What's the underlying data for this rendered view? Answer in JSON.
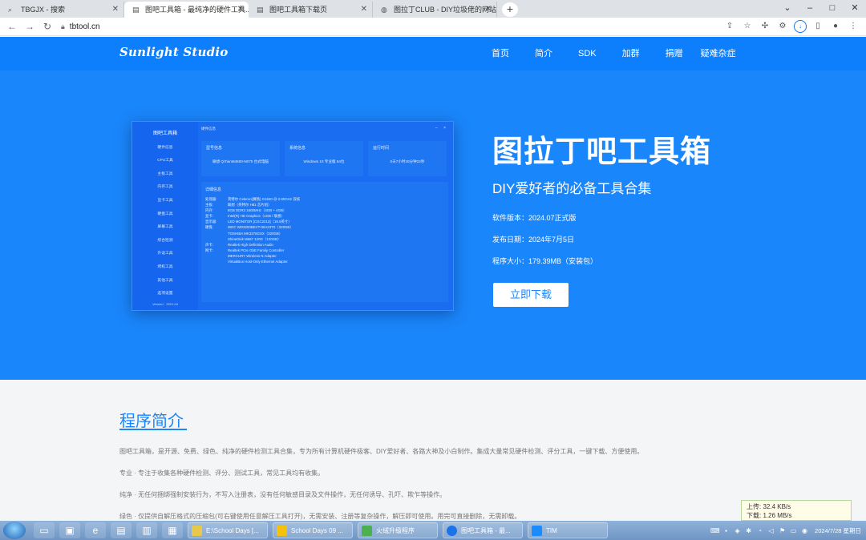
{
  "browser": {
    "tabs": [
      {
        "title": "TBGJX - 搜索",
        "icon": "search-icon",
        "active": false
      },
      {
        "title": "图吧工具箱 - 最纯净的硬件工具...",
        "icon": "page-icon",
        "active": true
      },
      {
        "title": "图吧工具箱下载页",
        "icon": "page-icon",
        "active": false
      },
      {
        "title": "图拉丁CLUB - DIY垃圾佬的网站",
        "icon": "globe-icon",
        "active": false
      }
    ],
    "new_tab": "+",
    "url": "tbtool.cn"
  },
  "site": {
    "logo": "Sunlight Studio",
    "nav": [
      "首页",
      "简介",
      "SDK",
      "加群",
      "捐赠",
      "疑难杂症"
    ]
  },
  "hero": {
    "title": "图拉丁吧工具箱",
    "subtitle": "DIY爱好者的必备工具合集",
    "version": "软件版本：2024.07正式版",
    "release_date": "发布日期：2024年7月5日",
    "size": "程序大小：179.39MB（安装包）",
    "download": "立即下载",
    "app_preview": {
      "sidebar_title": "图吧工具箱",
      "sidebar_items": [
        "硬件信息",
        "CPU工具",
        "主板工具",
        "内存工具",
        "显卡工具",
        "硬盘工具",
        "屏幕工具",
        "综合检测",
        "外设工具",
        "烤机工具",
        "其他工具",
        "选项设置"
      ],
      "version": "Version：2021.04",
      "header": "硬件信息",
      "cards": [
        {
          "title": "型号信息",
          "value": "联想 QiTianM4500-N070 台式电脑"
        },
        {
          "title": "系统信息",
          "value": "Windows 10 专业版 64位"
        },
        {
          "title": "运行时间",
          "value": "0天7小时40分钟22秒"
        }
      ],
      "detail_title": "详细信息",
      "details": [
        {
          "k": "处理器:",
          "v": "英特尔 Celeron(赛扬) G1840 @ 2.80GHz 双核"
        },
        {
          "k": "主板:",
          "v": "联想（英特尔 H81 芯片组）"
        },
        {
          "k": "内存:",
          "v": "8GB DDR3 1600MHz（4GB + 4GB）"
        },
        {
          "k": "显卡:",
          "v": "Intel(R) HD Graphics（1GB / 联想）"
        },
        {
          "k": "显示器:",
          "v": "LED MONITOR [CGC2213]（19.5英寸）"
        },
        {
          "k": "硬盘:",
          "v": "WDC WD3200BEVT-00A23T0（320GB）"
        },
        {
          "k": "",
          "v": "TOSHIBA MK3276GSX（320GB）"
        },
        {
          "k": "",
          "v": "ShineDisk M667 120G（120GB）"
        },
        {
          "k": "声卡:",
          "v": "Realtek High Definition Audio"
        },
        {
          "k": "网卡:",
          "v": "Realtek PCIe GbE Family Controller"
        },
        {
          "k": "",
          "v": "MERCURY Wireless N Adapter"
        },
        {
          "k": "",
          "v": "VirtualBox Host-Only Ethernet Adapter"
        }
      ]
    }
  },
  "intro": {
    "heading": "程序简介",
    "paragraphs": [
      "图吧工具箱，是开源、免费、绿色、纯净的硬件检测工具合集，专为所有计算机硬件极客、DIY爱好者、各路大神及小白制作。集成大量常见硬件检测、评分工具，一键下载、方便使用。",
      "专业 · 专注于收集各种硬件检测、评分、测试工具，常见工具均有收集。",
      "纯净 · 无任何捆绑强制安装行为，不写入注册表，没有任何敏感目录及文件操作，无任何诱导、孔吓、欺乍等操作。",
      "绿色 · 仅提供自解压格式的压缩包(可右键使用任意解压工具打开)，无需安装、注册等复杂操作，解压即可使用。用完可直接删除，无需卸载。"
    ]
  },
  "speed_widget": {
    "up": "上传: 32.4 KB/s",
    "down": "下载: 1.26 MB/s"
  },
  "taskbar": {
    "tasks": [
      {
        "label": "E:\\School Days [...",
        "color": "#e8c84a"
      },
      {
        "label": "School Days 09 ...",
        "color": "#f4c20d"
      },
      {
        "label": "火绒升级程序",
        "color": "#4caf50"
      },
      {
        "label": "图吧工具箱 - 最...",
        "color": "#1a73e8"
      },
      {
        "label": "TIM",
        "color": "#1a8cff"
      }
    ],
    "date": "2024/7/28 星期日"
  }
}
